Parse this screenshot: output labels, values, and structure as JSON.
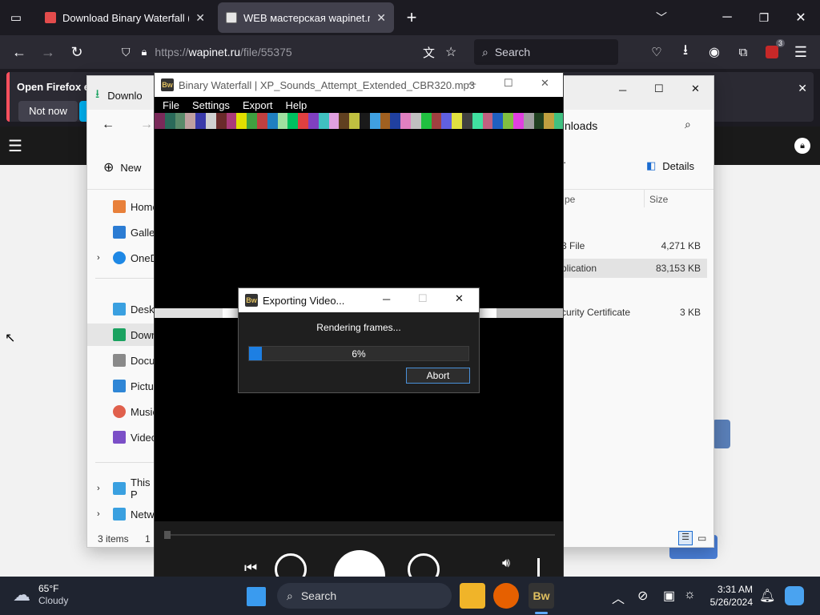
{
  "browser": {
    "tabs": [
      {
        "label": "Download Binary Waterfall (Wi",
        "active": false
      },
      {
        "label": "WEB мастерская wapinet.ru - ",
        "active": true
      }
    ],
    "url_prefix": "https://",
    "url_host": "wapinet.ru",
    "url_path": "/file/55375",
    "search_placeholder": "Search",
    "extension_badge": "3",
    "notice_text": "Open Firefox ev",
    "notice_button": "Not now"
  },
  "explorer": {
    "tab_label": "Downlo",
    "new_label": "New",
    "breadcrumb_tail": "nloads",
    "details_label": "Details",
    "col_type": "pe",
    "col_size": "Size",
    "sidebar": [
      {
        "label": "Home",
        "icon": "home-icon",
        "color": "#e8803a"
      },
      {
        "label": "Galler",
        "icon": "gallery-icon",
        "color": "#2b7cd3"
      },
      {
        "label": "OneD",
        "icon": "onedrive-icon",
        "color": "#1e88e5"
      },
      {
        "label": "Deskt",
        "icon": "desktop-icon",
        "color": "#3aa0e0"
      },
      {
        "label": "Down",
        "icon": "downloads-icon",
        "color": "#1aa260"
      },
      {
        "label": "Docu",
        "icon": "documents-icon",
        "color": "#8a8a8a"
      },
      {
        "label": "Pictu",
        "icon": "pictures-icon",
        "color": "#2f86d6"
      },
      {
        "label": "Music",
        "icon": "music-icon",
        "color": "#e0604c"
      },
      {
        "label": "Video",
        "icon": "videos-icon",
        "color": "#7b4fc7"
      },
      {
        "label": "This P",
        "icon": "this-pc-icon",
        "color": "#3aa0e0"
      },
      {
        "label": "Netw",
        "icon": "network-icon",
        "color": "#3aa0e0"
      }
    ],
    "files": [
      {
        "type": "3 File",
        "size": "4,271 KB",
        "selected": false
      },
      {
        "type": "plication",
        "size": "83,153 KB",
        "selected": true
      },
      {
        "type": "curity Certificate",
        "size": "3 KB",
        "selected": false
      }
    ],
    "status_items": "3 items",
    "status_extra": "1"
  },
  "bw": {
    "title": "Binary Waterfall | XP_Sounds_Attempt_Extended_CBR320.mp3",
    "app_icon_text": "Bw",
    "menu": [
      "File",
      "Settings",
      "Export",
      "Help"
    ],
    "stripe_colors": [
      "#7a2a5a",
      "#2a6a5a",
      "#5a8a6a",
      "#c0a0a0",
      "#3a3aaa",
      "#d0d0d0",
      "#6a2a2a",
      "#aa3a7a",
      "#e0e000",
      "#40a040",
      "#c04040",
      "#2080c0",
      "#a0e0a0",
      "#00c060",
      "#e04040",
      "#8040c0",
      "#40c0c0",
      "#e0a0e0",
      "#604020",
      "#c0c040",
      "#1a1a1a",
      "#40a0e0",
      "#a06020",
      "#2040a0",
      "#e080c0",
      "#c0c0c0",
      "#20c040",
      "#a04040",
      "#6060e0",
      "#e0e040",
      "#404040",
      "#40e0a0",
      "#c06080",
      "#2060c0",
      "#80c040",
      "#e040e0",
      "#a0a0a0",
      "#204020",
      "#c0a040",
      "#40c080"
    ],
    "stripe2_colors": [
      "#e0e0e0",
      "#ffffff",
      "#c8c8c8",
      "#f0f0f0",
      "#ffffff",
      "#bdbdbd"
    ]
  },
  "export": {
    "title": "Exporting Video...",
    "status": "Rendering frames...",
    "progress": 0.06,
    "progress_label": "6%",
    "abort_label": "Abort"
  },
  "taskbar": {
    "weather_temp": "65°F",
    "weather_desc": "Cloudy",
    "search_placeholder": "Search",
    "time": "3:31 AM",
    "date": "5/26/2024"
  }
}
